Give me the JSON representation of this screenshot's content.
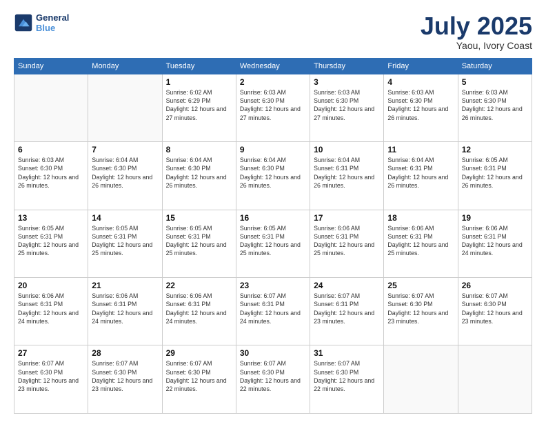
{
  "header": {
    "logo_line1": "General",
    "logo_line2": "Blue",
    "month": "July 2025",
    "location": "Yaou, Ivory Coast"
  },
  "weekdays": [
    "Sunday",
    "Monday",
    "Tuesday",
    "Wednesday",
    "Thursday",
    "Friday",
    "Saturday"
  ],
  "weeks": [
    [
      {
        "day": "",
        "info": ""
      },
      {
        "day": "",
        "info": ""
      },
      {
        "day": "1",
        "info": "Sunrise: 6:02 AM\nSunset: 6:29 PM\nDaylight: 12 hours and 27 minutes."
      },
      {
        "day": "2",
        "info": "Sunrise: 6:03 AM\nSunset: 6:30 PM\nDaylight: 12 hours and 27 minutes."
      },
      {
        "day": "3",
        "info": "Sunrise: 6:03 AM\nSunset: 6:30 PM\nDaylight: 12 hours and 27 minutes."
      },
      {
        "day": "4",
        "info": "Sunrise: 6:03 AM\nSunset: 6:30 PM\nDaylight: 12 hours and 26 minutes."
      },
      {
        "day": "5",
        "info": "Sunrise: 6:03 AM\nSunset: 6:30 PM\nDaylight: 12 hours and 26 minutes."
      }
    ],
    [
      {
        "day": "6",
        "info": "Sunrise: 6:03 AM\nSunset: 6:30 PM\nDaylight: 12 hours and 26 minutes."
      },
      {
        "day": "7",
        "info": "Sunrise: 6:04 AM\nSunset: 6:30 PM\nDaylight: 12 hours and 26 minutes."
      },
      {
        "day": "8",
        "info": "Sunrise: 6:04 AM\nSunset: 6:30 PM\nDaylight: 12 hours and 26 minutes."
      },
      {
        "day": "9",
        "info": "Sunrise: 6:04 AM\nSunset: 6:30 PM\nDaylight: 12 hours and 26 minutes."
      },
      {
        "day": "10",
        "info": "Sunrise: 6:04 AM\nSunset: 6:31 PM\nDaylight: 12 hours and 26 minutes."
      },
      {
        "day": "11",
        "info": "Sunrise: 6:04 AM\nSunset: 6:31 PM\nDaylight: 12 hours and 26 minutes."
      },
      {
        "day": "12",
        "info": "Sunrise: 6:05 AM\nSunset: 6:31 PM\nDaylight: 12 hours and 26 minutes."
      }
    ],
    [
      {
        "day": "13",
        "info": "Sunrise: 6:05 AM\nSunset: 6:31 PM\nDaylight: 12 hours and 25 minutes."
      },
      {
        "day": "14",
        "info": "Sunrise: 6:05 AM\nSunset: 6:31 PM\nDaylight: 12 hours and 25 minutes."
      },
      {
        "day": "15",
        "info": "Sunrise: 6:05 AM\nSunset: 6:31 PM\nDaylight: 12 hours and 25 minutes."
      },
      {
        "day": "16",
        "info": "Sunrise: 6:05 AM\nSunset: 6:31 PM\nDaylight: 12 hours and 25 minutes."
      },
      {
        "day": "17",
        "info": "Sunrise: 6:06 AM\nSunset: 6:31 PM\nDaylight: 12 hours and 25 minutes."
      },
      {
        "day": "18",
        "info": "Sunrise: 6:06 AM\nSunset: 6:31 PM\nDaylight: 12 hours and 25 minutes."
      },
      {
        "day": "19",
        "info": "Sunrise: 6:06 AM\nSunset: 6:31 PM\nDaylight: 12 hours and 24 minutes."
      }
    ],
    [
      {
        "day": "20",
        "info": "Sunrise: 6:06 AM\nSunset: 6:31 PM\nDaylight: 12 hours and 24 minutes."
      },
      {
        "day": "21",
        "info": "Sunrise: 6:06 AM\nSunset: 6:31 PM\nDaylight: 12 hours and 24 minutes."
      },
      {
        "day": "22",
        "info": "Sunrise: 6:06 AM\nSunset: 6:31 PM\nDaylight: 12 hours and 24 minutes."
      },
      {
        "day": "23",
        "info": "Sunrise: 6:07 AM\nSunset: 6:31 PM\nDaylight: 12 hours and 24 minutes."
      },
      {
        "day": "24",
        "info": "Sunrise: 6:07 AM\nSunset: 6:31 PM\nDaylight: 12 hours and 23 minutes."
      },
      {
        "day": "25",
        "info": "Sunrise: 6:07 AM\nSunset: 6:30 PM\nDaylight: 12 hours and 23 minutes."
      },
      {
        "day": "26",
        "info": "Sunrise: 6:07 AM\nSunset: 6:30 PM\nDaylight: 12 hours and 23 minutes."
      }
    ],
    [
      {
        "day": "27",
        "info": "Sunrise: 6:07 AM\nSunset: 6:30 PM\nDaylight: 12 hours and 23 minutes."
      },
      {
        "day": "28",
        "info": "Sunrise: 6:07 AM\nSunset: 6:30 PM\nDaylight: 12 hours and 23 minutes."
      },
      {
        "day": "29",
        "info": "Sunrise: 6:07 AM\nSunset: 6:30 PM\nDaylight: 12 hours and 22 minutes."
      },
      {
        "day": "30",
        "info": "Sunrise: 6:07 AM\nSunset: 6:30 PM\nDaylight: 12 hours and 22 minutes."
      },
      {
        "day": "31",
        "info": "Sunrise: 6:07 AM\nSunset: 6:30 PM\nDaylight: 12 hours and 22 minutes."
      },
      {
        "day": "",
        "info": ""
      },
      {
        "day": "",
        "info": ""
      }
    ]
  ]
}
